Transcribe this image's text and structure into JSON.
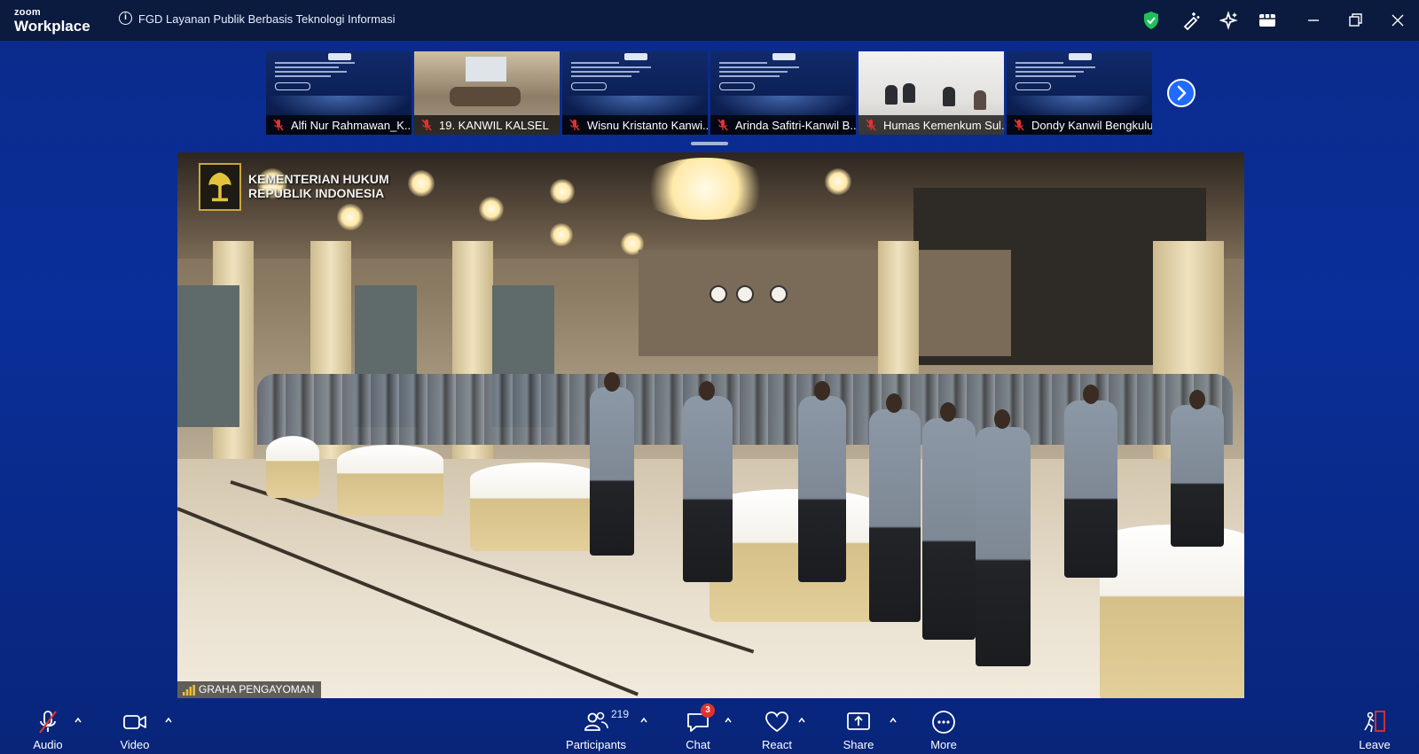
{
  "app": {
    "brand_small": "zoom",
    "brand_name": "Workplace",
    "meeting_title": "FGD Layanan Publik Berbasis Teknologi Informasi"
  },
  "filmstrip": {
    "participants": [
      {
        "name": "Alfi Nur Rahmawan_K...",
        "muted": true,
        "kind": "slide"
      },
      {
        "name": "19. KANWIL KALSEL",
        "muted": true,
        "kind": "room"
      },
      {
        "name": "Wisnu Kristanto Kanwi...",
        "muted": true,
        "kind": "slide"
      },
      {
        "name": "Arinda Safitri-Kanwil B...",
        "muted": true,
        "kind": "slide"
      },
      {
        "name": "Humas Kemenkum Sul...",
        "muted": true,
        "kind": "office"
      },
      {
        "name": "Dondy Kanwil Bengkulu",
        "muted": true,
        "kind": "slide"
      }
    ]
  },
  "main_video": {
    "logo_line1": "KEMENTERIAN HUKUM",
    "logo_line2": "REPUBLIK INDONESIA",
    "speaker_label": "GRAHA PENGAYOMAN"
  },
  "toolbar": {
    "audio_label": "Audio",
    "video_label": "Video",
    "participants_label": "Participants",
    "participants_count": "219",
    "chat_label": "Chat",
    "chat_badge": "3",
    "react_label": "React",
    "share_label": "Share",
    "more_label": "More",
    "leave_label": "Leave"
  },
  "colors": {
    "background": "#0a2f9a",
    "titlebar": "#0b1a3f",
    "accent": "#1f6bff",
    "shield": "#1fbf5a",
    "badge": "#e0322f",
    "mute": "#e0322f"
  },
  "icons": [
    "info-icon",
    "shield-icon",
    "annotate-icon",
    "ai-companion-icon",
    "apps-icon",
    "minimize-icon",
    "restore-icon",
    "close-icon",
    "mic-muted-icon",
    "camera-icon",
    "participants-icon",
    "chat-icon",
    "heart-icon",
    "share-screen-icon",
    "more-icon",
    "leave-icon",
    "chevron-right-icon",
    "signal-bars-icon"
  ]
}
